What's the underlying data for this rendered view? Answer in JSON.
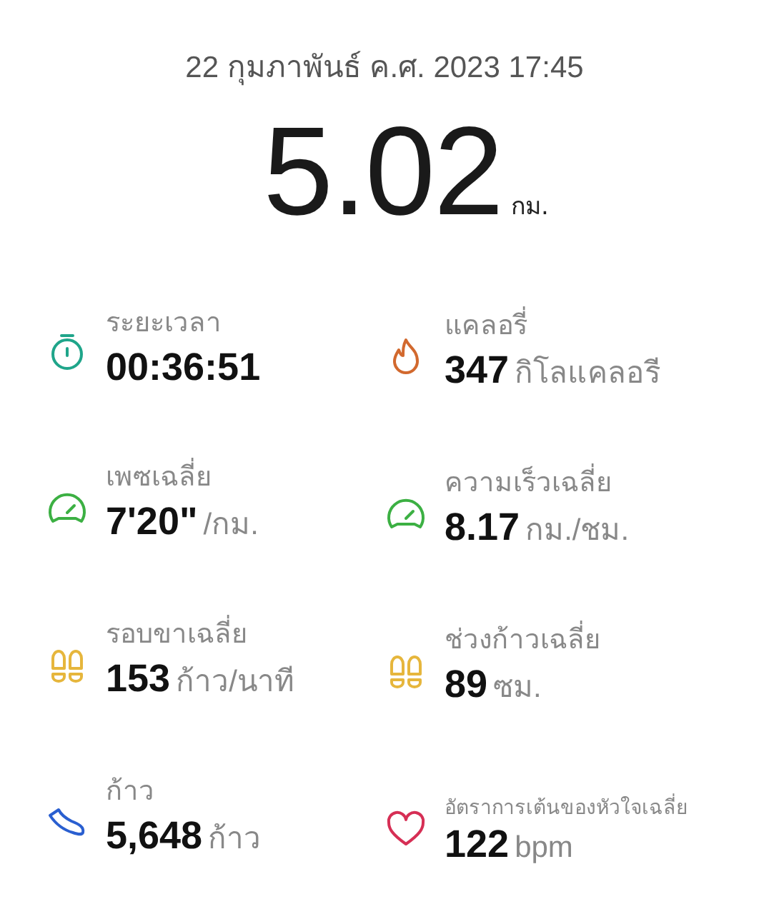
{
  "date": "22 กุมภาพันธ์ ค.ศ. 2023 17:45",
  "distance": {
    "value": "5.02",
    "unit": "กม."
  },
  "metrics": [
    {
      "kind": "stopwatch",
      "color": "#1fa58a",
      "label": "ระยะเวลา",
      "value": "00:36:51"
    },
    {
      "kind": "flame",
      "color": "#d2692e",
      "label": "แคลอรี่",
      "value": "347",
      "unit": "กิโลแคลอรี"
    },
    {
      "kind": "gauge",
      "color": "#3cb043",
      "label": "เพซเฉลี่ย",
      "value": "7'20\"",
      "unit": "/กม."
    },
    {
      "kind": "gauge",
      "color": "#3cb043",
      "label": "ความเร็วเฉลี่ย",
      "value": "8.17",
      "unit": "กม./ชม."
    },
    {
      "kind": "footprints",
      "color": "#e6b63c",
      "label": "รอบขาเฉลี่ย",
      "value": "153",
      "unit": "ก้าว/นาที"
    },
    {
      "kind": "footprints",
      "color": "#e6b63c",
      "label": "ช่วงก้าวเฉลี่ย",
      "value": "89",
      "unit": "ซม."
    },
    {
      "kind": "shoe",
      "color": "#2a5fd0",
      "label": "ก้าว",
      "value": "5,648",
      "unit": "ก้าว"
    },
    {
      "kind": "heart",
      "color": "#d62f55",
      "label": "อัตราการเต้นของหัวใจเฉลี่ย",
      "value": "122",
      "unit": "bpm",
      "small_label": true
    }
  ]
}
